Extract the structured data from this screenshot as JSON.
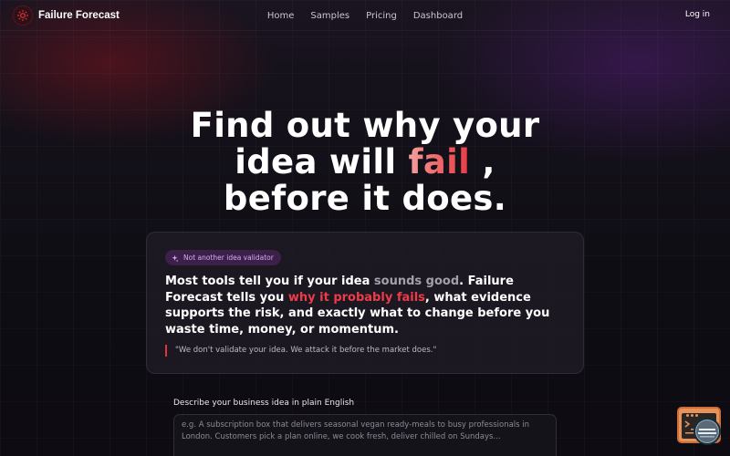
{
  "brand": {
    "name": "Failure Forecast",
    "accent": "#e2343f"
  },
  "nav": {
    "items": [
      "Home",
      "Samples",
      "Pricing",
      "Dashboard"
    ],
    "login": "Log in"
  },
  "hero": {
    "line1": "Find out why your",
    "line2_before": "idea will ",
    "line2_highlight": "fail",
    "line2_after": " ,",
    "line3": "before it does."
  },
  "card": {
    "badge": "Not another idea validator",
    "lead_1": "Most tools tell you if your idea ",
    "lead_muted": "sounds good",
    "lead_2": ". Failure Forecast tells you ",
    "lead_red": "why it probably fails",
    "lead_3": ", what evidence supports the risk, and exactly what to change before you waste time, money, or momentum.",
    "quote": "\"We don't validate your idea. We attack it before the market does.\""
  },
  "form": {
    "label": "Describe your business idea in plain English",
    "placeholder": "e.g. A subscription box that delivers seasonal vegan ready-meals to busy professionals in London. Customers pick a plan online, we cook fresh, deliver chilled on Sundays..."
  },
  "icons": {
    "logo": "gear-icon",
    "badge": "sparkle-icon",
    "widget": "chat-widget-icon"
  }
}
